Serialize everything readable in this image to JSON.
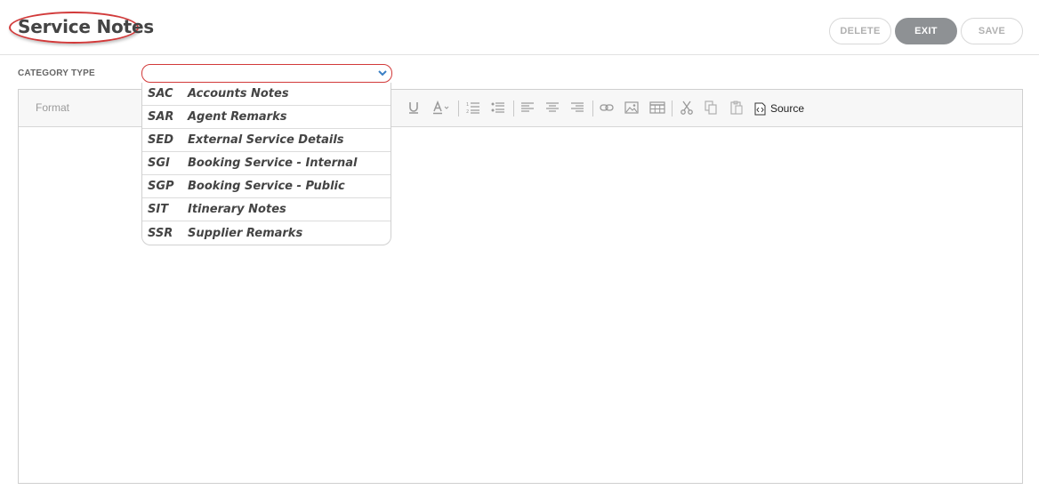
{
  "header": {
    "title": "Service Notes",
    "buttons": {
      "delete": "DELETE",
      "exit": "EXIT",
      "save": "SAVE"
    }
  },
  "category": {
    "label": "CATEGORY TYPE",
    "selected": "",
    "options": [
      {
        "code": "SAC",
        "label": "Accounts Notes"
      },
      {
        "code": "SAR",
        "label": "Agent Remarks"
      },
      {
        "code": "SED",
        "label": "External Service Details"
      },
      {
        "code": "SGI",
        "label": "Booking Service - Internal"
      },
      {
        "code": "SGP",
        "label": "Booking Service - Public"
      },
      {
        "code": "SIT",
        "label": "Itinerary Notes"
      },
      {
        "code": "SSR",
        "label": "Supplier Remarks"
      }
    ]
  },
  "editor": {
    "format_label": "Format",
    "source_label": "Source",
    "body": ""
  },
  "colors": {
    "accent_red": "#d23a3a",
    "exit_button": "#8e9194",
    "chevron": "#3a7fc4"
  }
}
